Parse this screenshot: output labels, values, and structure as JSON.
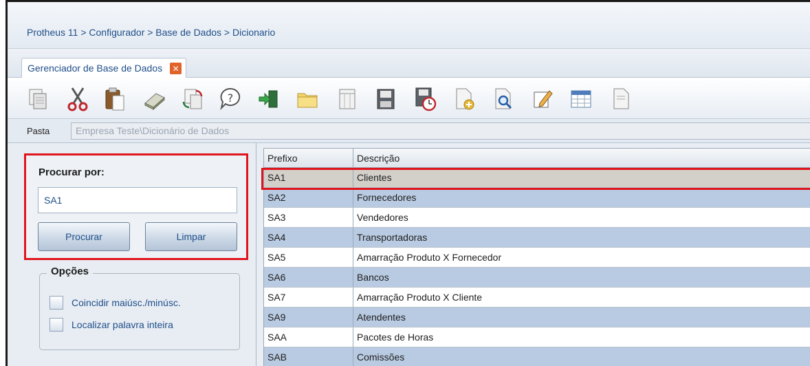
{
  "breadcrumb": "Protheus 11 > Configurador > Base de Dados > Dicionario",
  "tab": {
    "label": "Gerenciador de Base de Dados",
    "close_glyph": "✕"
  },
  "toolbar": {
    "icons": [
      "copy-icon",
      "cut-icon",
      "paste-icon",
      "eraser-icon",
      "refresh-icon",
      "help-icon",
      "exit-icon",
      "folder-icon",
      "table-view-icon",
      "save-icon",
      "save-schedule-icon",
      "add-document-icon",
      "search-document-icon",
      "edit-icon",
      "grid-icon",
      "document-icon"
    ]
  },
  "pasta": {
    "label": "Pasta",
    "value": "Empresa Teste\\Dicionário de Dados"
  },
  "search": {
    "title": "Procurar por:",
    "value": "SA1",
    "search_button": "Procurar",
    "clear_button": "Limpar"
  },
  "options": {
    "title": "Opções",
    "match_case": "Coincidir maiúsc./minúsc.",
    "whole_word": "Localizar palavra inteira"
  },
  "table": {
    "headers": [
      "Prefixo",
      "Descrição"
    ],
    "rows": [
      {
        "prefix": "SA1",
        "description": "Clientes",
        "selected": true
      },
      {
        "prefix": "SA2",
        "description": "Fornecedores"
      },
      {
        "prefix": "SA3",
        "description": "Vendedores"
      },
      {
        "prefix": "SA4",
        "description": "Transportadoras"
      },
      {
        "prefix": "SA5",
        "description": "Amarração Produto X Fornecedor"
      },
      {
        "prefix": "SA6",
        "description": "Bancos"
      },
      {
        "prefix": "SA7",
        "description": "Amarração Produto X Cliente"
      },
      {
        "prefix": "SA9",
        "description": "Atendentes"
      },
      {
        "prefix": "SAA",
        "description": "Pacotes de Horas"
      },
      {
        "prefix": "SAB",
        "description": "Comissões"
      }
    ]
  },
  "colors": {
    "highlight_outline": "#e0141b",
    "link_text": "#1f4e89",
    "row_alt": "#b9cbe2",
    "row_selected": "#d3d0ca"
  }
}
